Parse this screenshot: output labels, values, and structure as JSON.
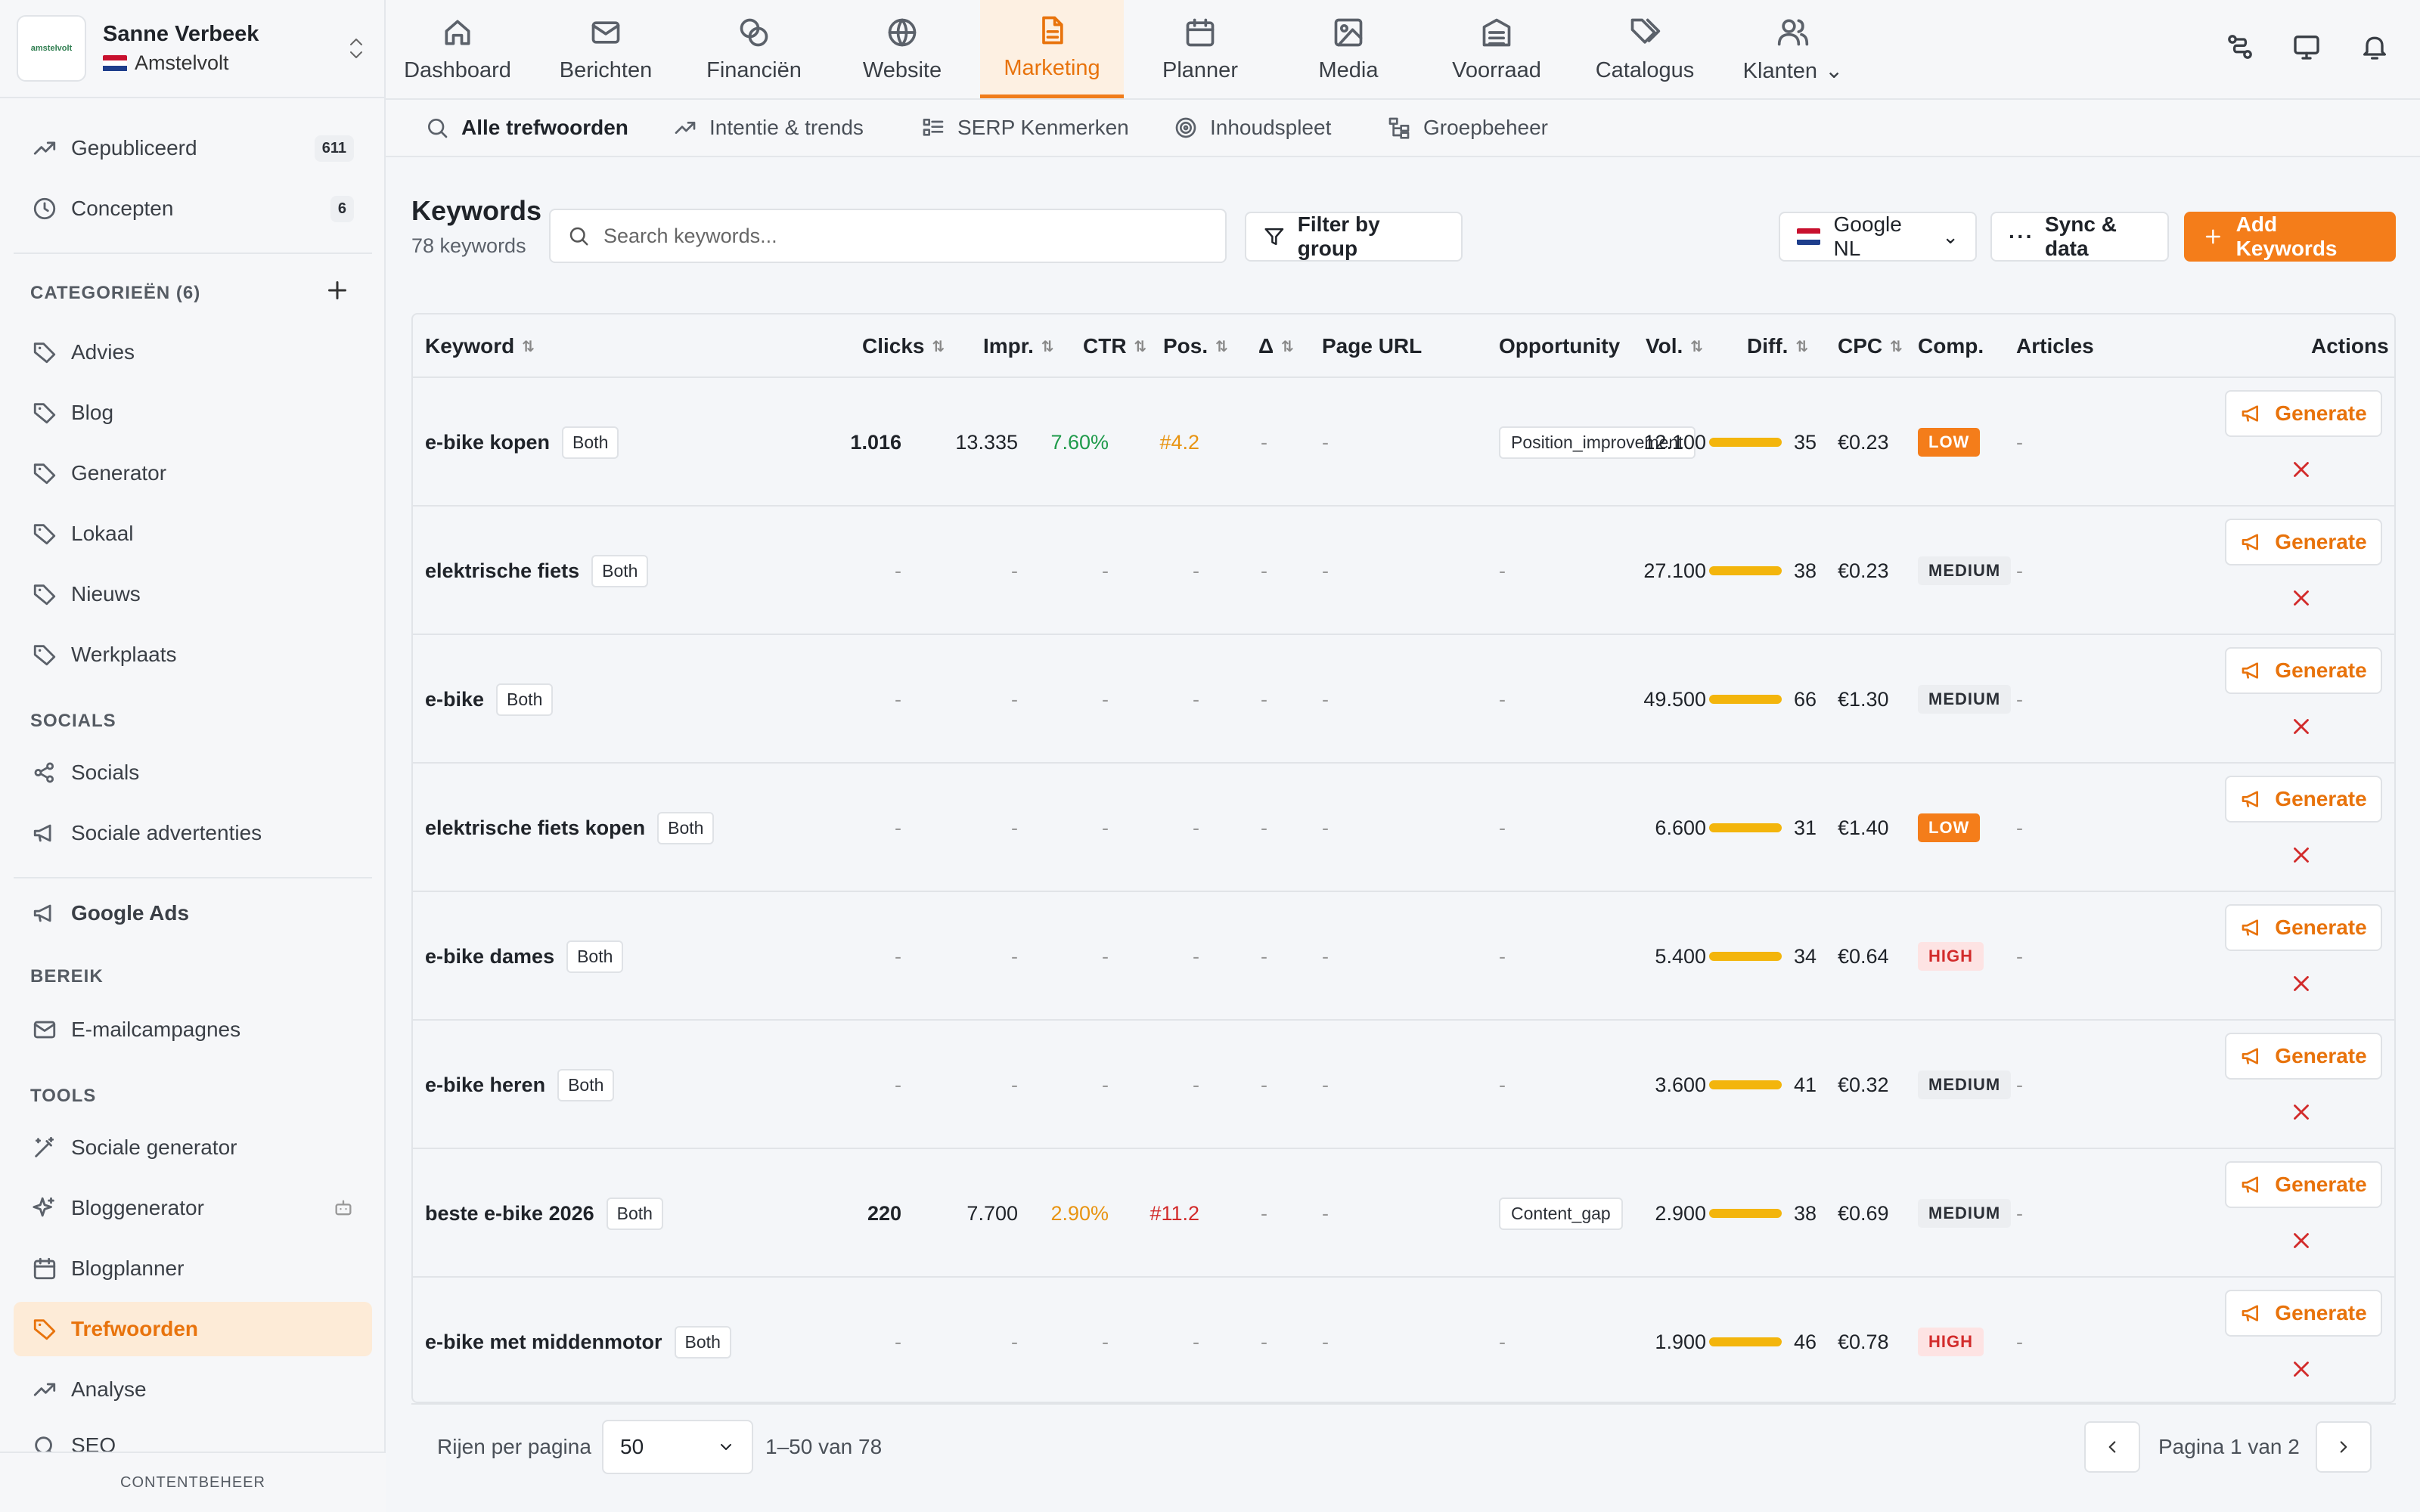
{
  "account": {
    "name": "Sanne Verbeek",
    "location": "Amstelvolt",
    "logo_text": "amstelvolt"
  },
  "sidebar": {
    "top_items": [
      {
        "label": "Gepubliceerd",
        "badge": "611"
      },
      {
        "label": "Concepten",
        "badge": "6"
      }
    ],
    "categories_label": "CATEGORIEËN (6)",
    "categories": [
      "Advies",
      "Blog",
      "Generator",
      "Lokaal",
      "Nieuws",
      "Werkplaats"
    ],
    "socials_label": "SOCIALS",
    "socials": [
      "Socials",
      "Sociale advertenties"
    ],
    "google_ads": "Google Ads",
    "bereik_label": "BEREIK",
    "bereik": [
      "E-mailcampagnes"
    ],
    "tools_label": "TOOLS",
    "tools": [
      "Sociale generator",
      "Bloggenerator",
      "Blogplanner",
      "Trefwoorden",
      "Analyse",
      "SEO"
    ],
    "footer": "CONTENTBEHEER"
  },
  "topnav": {
    "tabs": [
      "Dashboard",
      "Berichten",
      "Financiën",
      "Website",
      "Marketing",
      "Planner",
      "Media",
      "Voorraad",
      "Catalogus",
      "Klanten"
    ]
  },
  "subnav": {
    "tabs": [
      "Alle trefwoorden",
      "Intentie & trends",
      "SERP Kenmerken",
      "Inhoudspleet",
      "Groepbeheer"
    ]
  },
  "toolbar": {
    "title": "Keywords",
    "count": "78 keywords",
    "search_placeholder": "Search keywords...",
    "filter_label": "Filter by group",
    "engine_label": "Google NL",
    "sync_label": "Sync & data",
    "add_label": "Add Keywords"
  },
  "table": {
    "headers": {
      "keyword": "Keyword",
      "clicks": "Clicks",
      "impr": "Impr.",
      "ctr": "CTR",
      "pos": "Pos.",
      "delta": "Δ",
      "url": "Page URL",
      "opp": "Opportunity",
      "vol": "Vol.",
      "diff": "Diff.",
      "cpc": "CPC",
      "comp": "Comp.",
      "articles": "Articles",
      "actions": "Actions"
    },
    "generate_label": "Generate",
    "rows": [
      {
        "keyword": "e-bike kopen",
        "badge": "Both",
        "clicks": "1.016",
        "impr": "13.335",
        "ctr": "7.60%",
        "pos": "#4.2",
        "delta": "-",
        "url": "-",
        "opp": "Position_improvement",
        "vol": "12.100",
        "diff": "35",
        "cpc": "€0.23",
        "comp": "LOW",
        "articles": "-"
      },
      {
        "keyword": "elektrische fiets",
        "badge": "Both",
        "clicks": "-",
        "impr": "-",
        "ctr": "-",
        "pos": "-",
        "delta": "-",
        "url": "-",
        "opp": "-",
        "vol": "27.100",
        "diff": "38",
        "cpc": "€0.23",
        "comp": "MEDIUM",
        "articles": "-"
      },
      {
        "keyword": "e-bike",
        "badge": "Both",
        "clicks": "-",
        "impr": "-",
        "ctr": "-",
        "pos": "-",
        "delta": "-",
        "url": "-",
        "opp": "-",
        "vol": "49.500",
        "diff": "66",
        "cpc": "€1.30",
        "comp": "MEDIUM",
        "articles": "-"
      },
      {
        "keyword": "elektrische fiets kopen",
        "badge": "Both",
        "clicks": "-",
        "impr": "-",
        "ctr": "-",
        "pos": "-",
        "delta": "-",
        "url": "-",
        "opp": "-",
        "vol": "6.600",
        "diff": "31",
        "cpc": "€1.40",
        "comp": "LOW",
        "articles": "-"
      },
      {
        "keyword": "e-bike dames",
        "badge": "Both",
        "clicks": "-",
        "impr": "-",
        "ctr": "-",
        "pos": "-",
        "delta": "-",
        "url": "-",
        "opp": "-",
        "vol": "5.400",
        "diff": "34",
        "cpc": "€0.64",
        "comp": "HIGH",
        "articles": "-"
      },
      {
        "keyword": "e-bike heren",
        "badge": "Both",
        "clicks": "-",
        "impr": "-",
        "ctr": "-",
        "pos": "-",
        "delta": "-",
        "url": "-",
        "opp": "-",
        "vol": "3.600",
        "diff": "41",
        "cpc": "€0.32",
        "comp": "MEDIUM",
        "articles": "-"
      },
      {
        "keyword": "beste e-bike 2026",
        "badge": "Both",
        "clicks": "220",
        "impr": "7.700",
        "ctr": "2.90%",
        "pos": "#11.2",
        "delta": "-",
        "url": "-",
        "opp": "Content_gap",
        "vol": "2.900",
        "diff": "38",
        "cpc": "€0.69",
        "comp": "MEDIUM",
        "articles": "-"
      },
      {
        "keyword": "e-bike met middenmotor",
        "badge": "Both",
        "clicks": "-",
        "impr": "-",
        "ctr": "-",
        "pos": "-",
        "delta": "-",
        "url": "-",
        "opp": "-",
        "vol": "1.900",
        "diff": "46",
        "cpc": "€0.78",
        "comp": "HIGH",
        "articles": "-"
      }
    ]
  },
  "pagination": {
    "rows_label": "Rijen per pagina",
    "rows_value": "50",
    "range": "1–50 van 78",
    "page_label": "Pagina 1 van 2"
  },
  "colors": {
    "accent": "#f47d1a",
    "positive": "#1e9a4a",
    "warning": "#e89412",
    "danger": "#d22b2b",
    "difficulty": "#f3b50c"
  }
}
